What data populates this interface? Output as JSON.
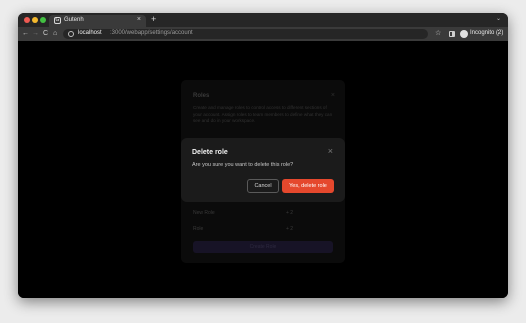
{
  "browser": {
    "tab": {
      "title": "Gutenh",
      "favicon": "G",
      "close": "×"
    },
    "new_tab": "+",
    "tab_menu": "⌄",
    "nav": {
      "back": "←",
      "forward": "→",
      "reload": "C",
      "home": "⌂"
    },
    "url": {
      "host": "localhost",
      "path": ":3000/webapp/settings/account"
    },
    "star": "☆",
    "incognito_label": "Incognito (2)",
    "menu": "⋮"
  },
  "background_card": {
    "title": "Roles",
    "close": "×",
    "description": "Create and manage roles to control access to different sections of your account. Assign roles to team members to define what they can see and do in your workspace.",
    "rows": [
      {
        "label": "New Role",
        "value": "+ 2"
      },
      {
        "label": "Role",
        "value": "+ 2"
      }
    ],
    "button_label": "Create Role"
  },
  "modal": {
    "title": "Delete role",
    "close": "×",
    "message": "Are you sure you want to delete this role?",
    "cancel_label": "Cancel",
    "confirm_label": "Yes, delete role"
  },
  "colors": {
    "confirm": "#e5482d",
    "modal_bg": "#1b1b1b",
    "page_bg": "#000000"
  }
}
